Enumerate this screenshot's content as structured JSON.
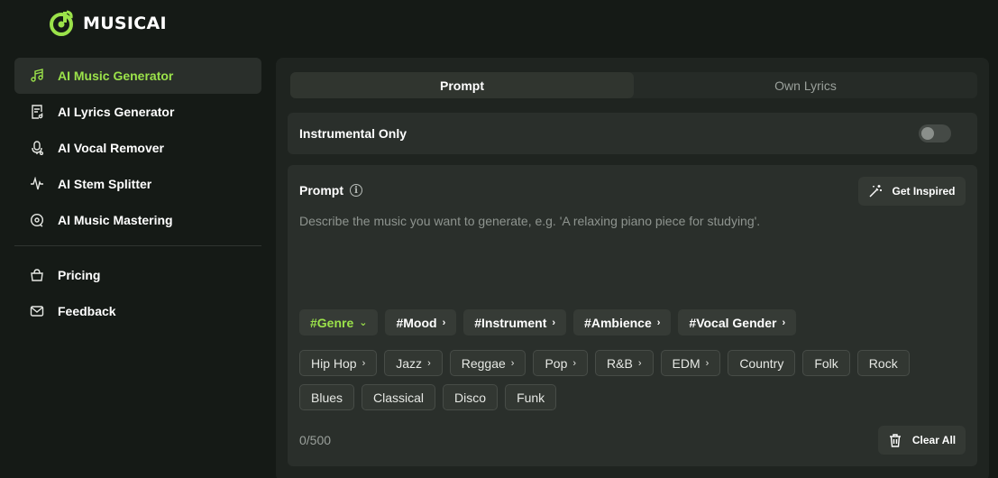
{
  "brand": {
    "name": "MUSICAI",
    "accent": "#9be24a"
  },
  "sidebar": {
    "items": [
      {
        "label": "AI Music Generator",
        "icon": "music-note-icon",
        "active": true
      },
      {
        "label": "AI Lyrics Generator",
        "icon": "lyrics-doc-icon"
      },
      {
        "label": "AI Vocal Remover",
        "icon": "mic-icon"
      },
      {
        "label": "AI Stem Splitter",
        "icon": "waveform-icon"
      },
      {
        "label": "AI Music Mastering",
        "icon": "disc-icon"
      }
    ],
    "secondary": [
      {
        "label": "Pricing",
        "icon": "basket-icon"
      },
      {
        "label": "Feedback",
        "icon": "mail-icon"
      }
    ]
  },
  "tabs": [
    {
      "label": "Prompt",
      "active": true
    },
    {
      "label": "Own Lyrics"
    }
  ],
  "instrumental": {
    "label": "Instrumental Only",
    "enabled": false
  },
  "prompt": {
    "title": "Prompt",
    "inspire_label": "Get Inspired",
    "placeholder": "Describe the music you want to generate, e.g. 'A relaxing piano piece for studying'.",
    "categories": [
      "#Genre",
      "#Mood",
      "#Instrument",
      "#Ambience",
      "#Vocal Gender"
    ],
    "genres_row1": [
      "Hip Hop",
      "Jazz",
      "Reggae",
      "Pop",
      "R&B",
      "EDM",
      "Country",
      "Folk",
      "Rock"
    ],
    "genres_row2": [
      "Blues",
      "Classical",
      "Disco",
      "Funk"
    ],
    "counter": "0/500",
    "clear_label": "Clear All"
  }
}
